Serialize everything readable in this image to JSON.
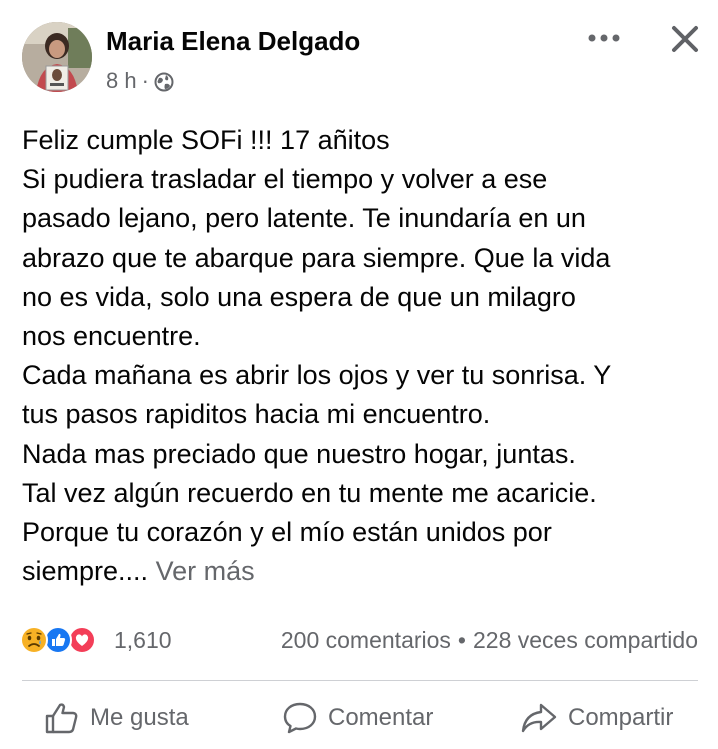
{
  "post": {
    "author": "Maria Elena Delgado",
    "time": "8 h",
    "separator": "·",
    "privacy_icon": "globe-icon",
    "more_icon": "more-horizontal-icon",
    "close_icon": "close-icon",
    "text_lines": [
      "Feliz cumple SOFi !!! 17 añitos",
      "Si pudiera trasladar el tiempo y volver a ese",
      "pasado lejano, pero latente. Te inundaría en un",
      "abrazo que te abarque para siempre. Que la vida",
      "no es vida, solo una espera de que un milagro",
      "nos encuentre.",
      "Cada mañana es abrir los ojos y ver tu sonrisa. Y",
      "tus pasos rapiditos hacia mi encuentro.",
      "Nada mas preciado que nuestro hogar, juntas.",
      "Tal vez algún recuerdo en tu mente me acaricie.",
      "Porque tu corazón y el mío están unidos por"
    ],
    "last_line": "siempre....",
    "see_more": "Ver más"
  },
  "stats": {
    "reactions": [
      "sad",
      "like",
      "love"
    ],
    "reaction_count": "1,610",
    "comments": "200 comentarios",
    "bullet": "•",
    "shares": "228 veces compartido"
  },
  "actions": {
    "like": "Me gusta",
    "comment": "Comentar",
    "share": "Compartir"
  },
  "colors": {
    "text": "#050505",
    "secondary": "#65676b",
    "like_blue": "#1877f2",
    "love_red": "#f33e58",
    "sad_yellow": "#f7b125"
  }
}
